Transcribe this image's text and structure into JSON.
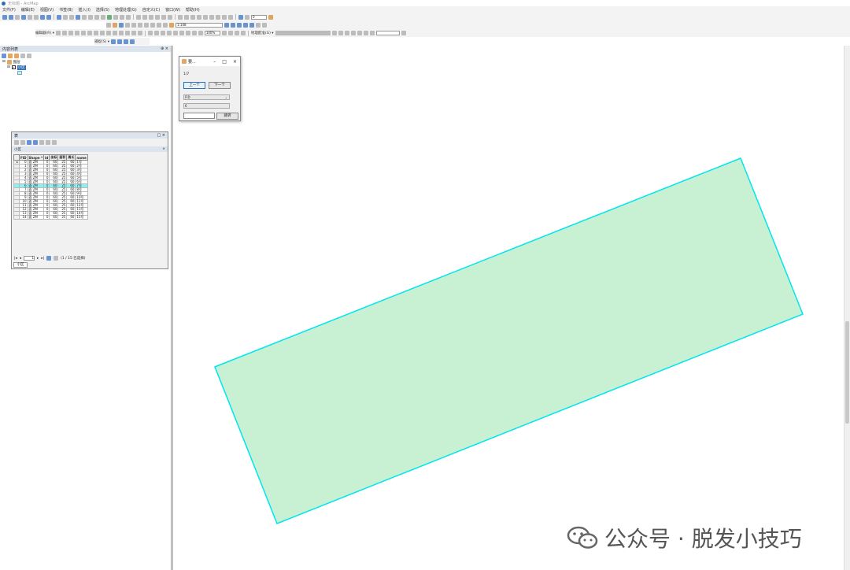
{
  "window": {
    "title": "无标题 - ArcMap"
  },
  "menu": [
    "文件(F)",
    "编辑(E)",
    "视图(V)",
    "书签(B)",
    "插入(I)",
    "选择(S)",
    "地理处理(G)",
    "自定义(C)",
    "窗口(W)",
    "帮助(H)"
  ],
  "toolbar": {
    "scale_value": "1:108",
    "editor_label": "编辑器(R) ▾",
    "zoom_value": "100%",
    "georef_label": "地理配准(G) ▾",
    "snapping_label": "捕捉(S) ▾",
    "field_dropdown": "0"
  },
  "toc": {
    "title": "内容列表",
    "layers_label": "图层",
    "layer_name": "小区"
  },
  "table_window": {
    "title": "表",
    "tab_name": "小区",
    "columns": [
      "FID",
      "Shape *",
      "Id",
      "坐标",
      "面积",
      "周长",
      "name"
    ],
    "rows": [
      [
        "0",
        "面 ZM",
        "0",
        "60",
        "25",
        "60",
        "1号"
      ],
      [
        "1",
        "面 ZM",
        "0",
        "60",
        "25",
        "60",
        "2号"
      ],
      [
        "2",
        "面 ZM",
        "0",
        "60",
        "25",
        "60",
        "3号"
      ],
      [
        "3",
        "面 ZM",
        "0",
        "60",
        "25",
        "60",
        "4号"
      ],
      [
        "4",
        "面 ZM",
        "0",
        "60",
        "25",
        "60",
        "5号"
      ],
      [
        "5",
        "面 ZM",
        "0",
        "60",
        "25",
        "60",
        "6号"
      ],
      [
        "6",
        "面 ZM",
        "0",
        "60",
        "25",
        "60",
        "7号"
      ],
      [
        "7",
        "面 ZM",
        "0",
        "60",
        "25",
        "60",
        "8号"
      ],
      [
        "8",
        "面 ZM",
        "0",
        "60",
        "25",
        "60",
        "9号"
      ],
      [
        "9",
        "面 ZM",
        "0",
        "60",
        "25",
        "60",
        "10号"
      ],
      [
        "10",
        "面 ZM",
        "0",
        "60",
        "25",
        "60",
        "11号"
      ],
      [
        "11",
        "面 ZM",
        "0",
        "60",
        "25",
        "60",
        "12号"
      ],
      [
        "12",
        "面 ZM",
        "0",
        "60",
        "25",
        "60",
        "13号"
      ],
      [
        "13",
        "面 ZM",
        "0",
        "60",
        "25",
        "60",
        "14号"
      ],
      [
        "14",
        "面 ZM",
        "0",
        "60",
        "25",
        "60",
        "15号"
      ]
    ],
    "selected_row": 6,
    "record_number": "1",
    "status_text": "(1 / 15 已选择)"
  },
  "dialog": {
    "title": "要...",
    "counter": "1/7",
    "prev_label": "上一个",
    "next_label": "下一个",
    "field_combo": "FID",
    "field_value": "6",
    "goto_label": "跳转"
  },
  "watermark": {
    "text": "公众号 · 脱发小技巧"
  },
  "colors": {
    "polygon_fill": "#c8f0d2",
    "polygon_stroke": "#00e5ee",
    "selected_row": "#8ff0f0"
  }
}
